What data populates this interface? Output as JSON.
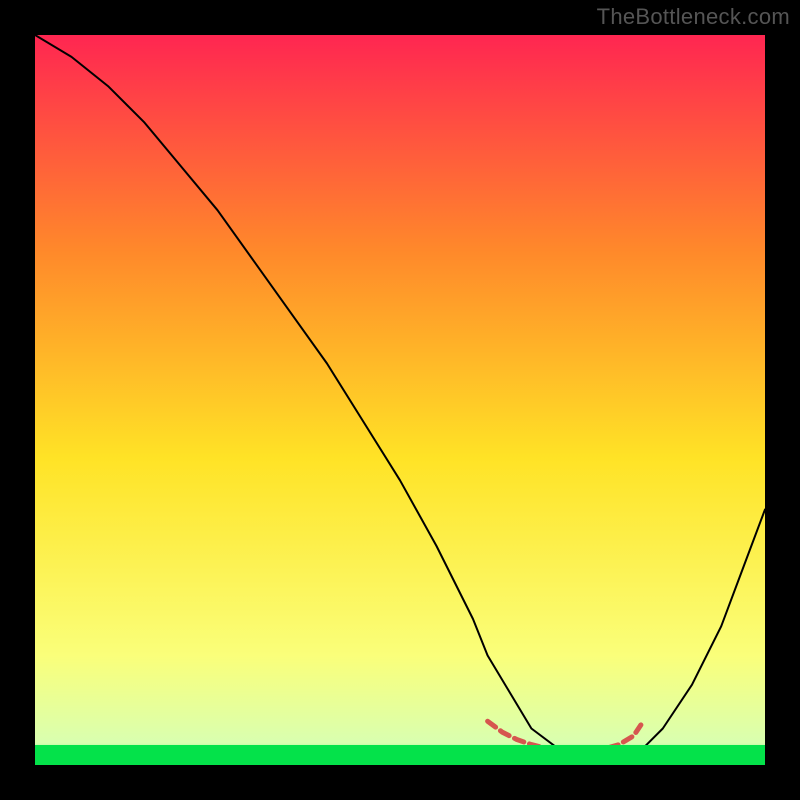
{
  "watermark": "TheBottleneck.com",
  "chart_data": {
    "type": "line",
    "title": "",
    "xlabel": "",
    "ylabel": "",
    "xlim": [
      0,
      100
    ],
    "ylim": [
      0,
      100
    ],
    "grid": false,
    "background_gradient": {
      "top": "#ff2651",
      "mid_upper": "#ff8a2a",
      "mid": "#ffe326",
      "mid_lower": "#faff7a",
      "bottom": "#04e24a"
    },
    "series": [
      {
        "name": "bottleneck-curve",
        "color": "#000000",
        "x": [
          0,
          5,
          10,
          15,
          20,
          25,
          30,
          35,
          40,
          45,
          50,
          55,
          60,
          62,
          65,
          68,
          72,
          76,
          80,
          83,
          86,
          90,
          94,
          97,
          100
        ],
        "y": [
          100,
          97,
          93,
          88,
          82,
          76,
          69,
          62,
          55,
          47,
          39,
          30,
          20,
          15,
          10,
          5,
          2,
          1.5,
          1.5,
          2,
          5,
          11,
          19,
          27,
          35
        ]
      },
      {
        "name": "optimal-region-marker",
        "color": "#d6564f",
        "stroke_width": 5,
        "x": [
          62,
          64,
          66,
          68,
          70,
          72,
          74,
          76,
          78,
          80,
          82,
          83
        ],
        "y": [
          6,
          4.5,
          3.5,
          2.8,
          2.3,
          2.0,
          2.0,
          2.0,
          2.2,
          2.8,
          4.0,
          5.5
        ]
      }
    ]
  }
}
